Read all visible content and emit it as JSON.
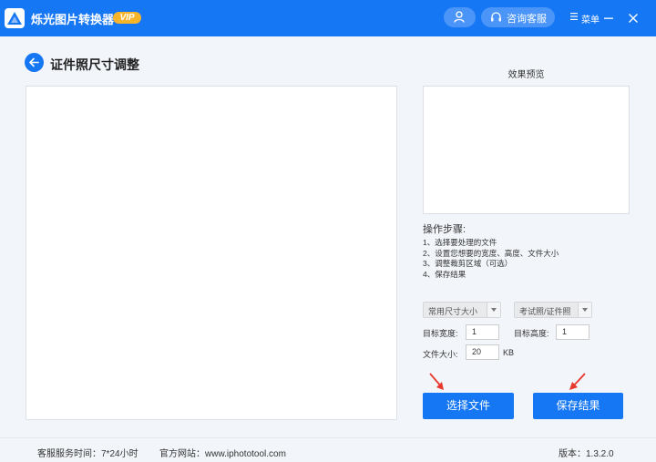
{
  "app": {
    "title": "烁光图片转换器",
    "vip_badge": "VIP"
  },
  "titlebar": {
    "service_label": "咨询客服",
    "menu_label": "菜单"
  },
  "page": {
    "title": "证件照尺寸调整"
  },
  "preview": {
    "label": "效果预览"
  },
  "steps": {
    "title": "操作步骤:",
    "items": [
      "1、选择要处理的文件",
      "2、设置您想要的宽度、高度、文件大小",
      "3、调整裁剪区域（可选）",
      "4、保存结果"
    ]
  },
  "form": {
    "size_preset": "常用尺寸大小",
    "photo_type": "考试照/证件照",
    "width_label": "目标宽度:",
    "width_value": "1",
    "height_label": "目标高度:",
    "height_value": "1",
    "filesize_label": "文件大小:",
    "filesize_value": "20",
    "filesize_unit": "KB"
  },
  "actions": {
    "choose_file": "选择文件",
    "save_result": "保存结果"
  },
  "footer": {
    "service_hours": "客服服务时间：7*24小时",
    "website": "官方网站：www.iphototool.com",
    "version": "版本：1.3.2.0"
  },
  "colors": {
    "primary": "#1677f5",
    "vip": "#f6b42b",
    "annotation_arrow": "#e8372d"
  }
}
